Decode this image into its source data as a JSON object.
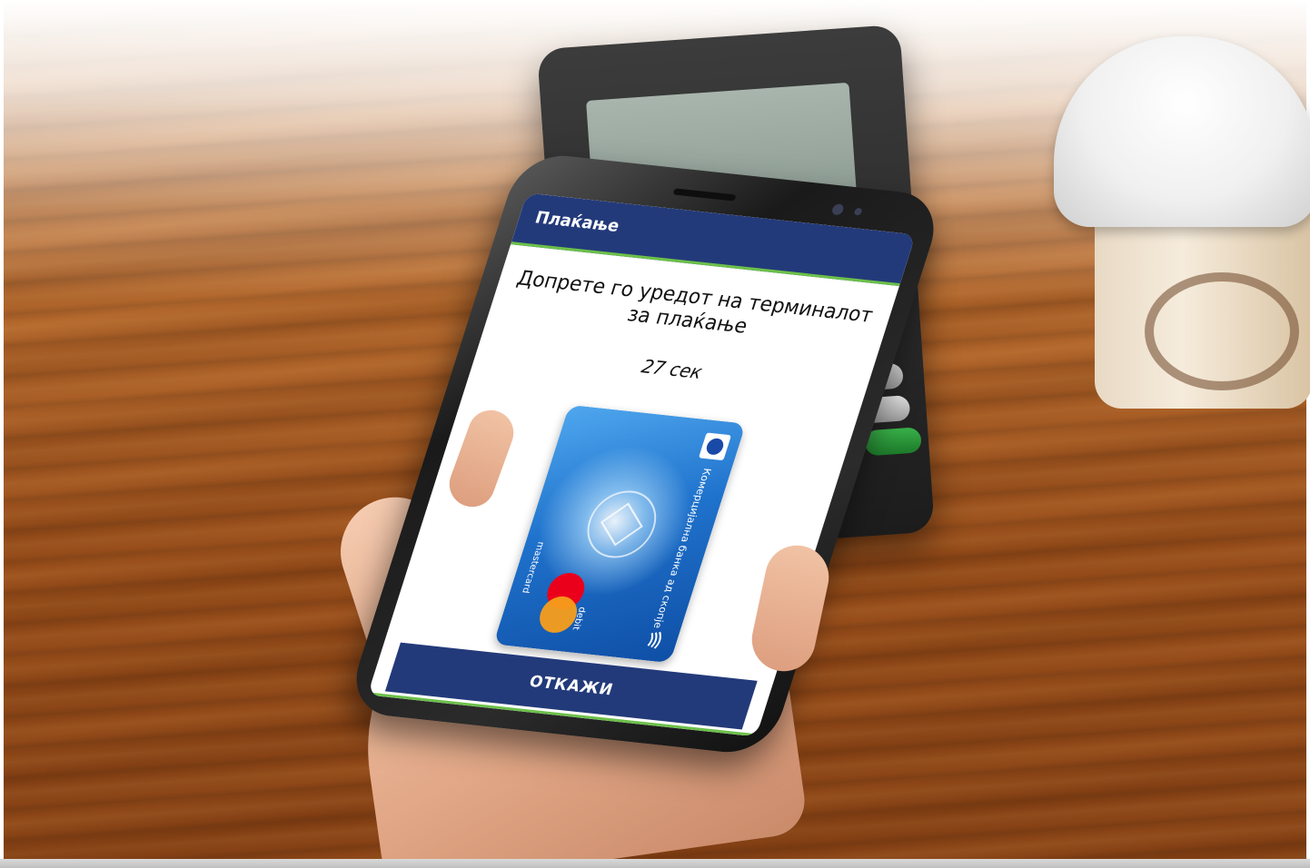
{
  "app": {
    "title": "Плаќање"
  },
  "payment": {
    "instruction": "Допрете го уредот на терминалот за плаќање",
    "countdown": "27 сек",
    "cancel_label": "ОТКАЖИ"
  },
  "card": {
    "bank_name": "Комерцијална банка ад скопје",
    "type_label": "debit",
    "brand_label": "mastercard"
  },
  "colors": {
    "header_blue": "#233a7a",
    "accent_green": "#6cc04a",
    "mastercard_red": "#eb001b",
    "mastercard_orange": "#f79e1b"
  },
  "icons": {
    "contactless": "contactless-icon",
    "bank_logo": "bank-logo-icon"
  }
}
